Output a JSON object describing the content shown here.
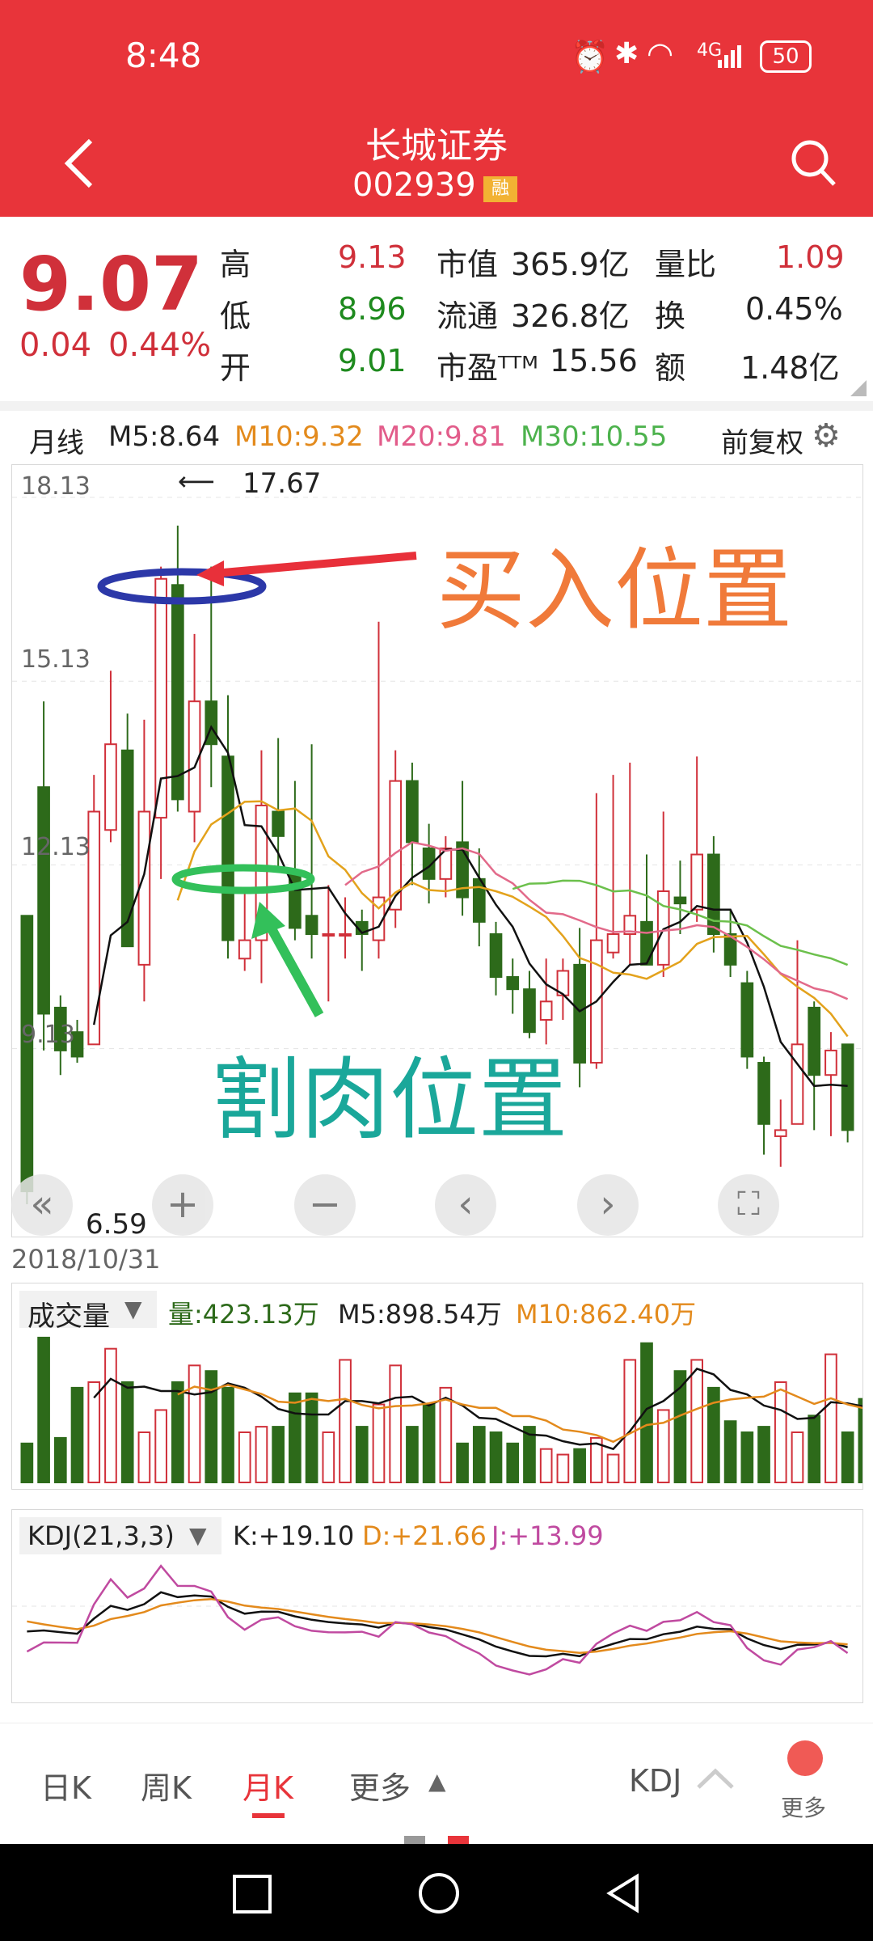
{
  "status": {
    "time": "8:48",
    "battery": "50",
    "network": "4G"
  },
  "header": {
    "stock_name": "长城证券",
    "stock_code": "002939",
    "rong_badge": "融"
  },
  "quote": {
    "price": "9.07",
    "change": "0.04",
    "change_pct": "0.44%",
    "high_label": "高",
    "high": "9.13",
    "low_label": "低",
    "low": "8.96",
    "open_label": "开",
    "open": "9.01",
    "mcap_label": "市值",
    "mcap": "365.9亿",
    "float_label": "流通",
    "float": "326.8亿",
    "pe_label": "市盈ᵀᵀᴹ",
    "pe": "15.56",
    "vr_label": "量比",
    "vr": "1.09",
    "turnover_label": "换",
    "turnover": "0.45%",
    "amount_label": "额",
    "amount": "1.48亿"
  },
  "ma_bar": {
    "period": "月线",
    "m5": "M5:8.64",
    "m10": "M10:9.32",
    "m20": "M20:9.81",
    "m30": "M30:10.55",
    "adjust": "前复权"
  },
  "main_chart": {
    "y_labels": [
      "18.13",
      "15.13",
      "12.13",
      "9.13"
    ],
    "max_annotation": "17.67",
    "min_annotation": "6.59",
    "date": "2018/10/31",
    "buy_label": "买入位置",
    "sell_label": "割肉位置"
  },
  "volume": {
    "selector": "成交量",
    "vol": "量:423.13万",
    "m5": "M5:898.54万",
    "m10": "M10:862.40万"
  },
  "kdj": {
    "selector": "KDJ(21,3,3)",
    "k": "K:+19.10",
    "d": "D:+21.66",
    "j": "J:+13.99"
  },
  "bottom_tabs": {
    "day": "日K",
    "week": "周K",
    "month": "月K",
    "more": "更多",
    "indicator": "KDJ",
    "more2": "更多"
  },
  "colors": {
    "up": "#d0303a",
    "down": "#2d6a1a",
    "header": "#e8343a"
  },
  "chart_data": {
    "type": "candlestick",
    "period": "monthly",
    "yrange": [
      6.59,
      18.13
    ],
    "candles": [
      {
        "o": 11.3,
        "c": 6.8,
        "h": 11.3,
        "l": 6.59
      },
      {
        "o": 13.4,
        "c": 9.7,
        "h": 14.8,
        "l": 9.1
      },
      {
        "o": 9.8,
        "c": 9.1,
        "h": 10.0,
        "l": 8.7
      },
      {
        "o": 9.4,
        "c": 9.0,
        "h": 9.6,
        "l": 8.9
      },
      {
        "o": 9.2,
        "c": 13.0,
        "h": 13.6,
        "l": 9.2
      },
      {
        "o": 12.7,
        "c": 14.1,
        "h": 15.3,
        "l": 12.5
      },
      {
        "o": 14.0,
        "c": 10.8,
        "h": 14.6,
        "l": 10.8
      },
      {
        "o": 10.5,
        "c": 13.0,
        "h": 14.5,
        "l": 9.9
      },
      {
        "o": 12.9,
        "c": 16.8,
        "h": 17.0,
        "l": 11.9
      },
      {
        "o": 16.7,
        "c": 13.2,
        "h": 17.67,
        "l": 13.0
      },
      {
        "o": 13.0,
        "c": 14.8,
        "h": 15.9,
        "l": 12.5
      },
      {
        "o": 14.8,
        "c": 14.1,
        "h": 17.0,
        "l": 13.4
      },
      {
        "o": 13.9,
        "c": 10.9,
        "h": 14.9,
        "l": 10.6
      },
      {
        "o": 10.6,
        "c": 10.9,
        "h": 11.7,
        "l": 10.4
      },
      {
        "o": 10.9,
        "c": 13.1,
        "h": 14.0,
        "l": 10.2
      },
      {
        "o": 13.0,
        "c": 12.6,
        "h": 14.2,
        "l": 12.1
      },
      {
        "o": 12.0,
        "c": 11.1,
        "h": 13.5,
        "l": 10.9
      },
      {
        "o": 11.3,
        "c": 11.0,
        "h": 14.1,
        "l": 10.6
      },
      {
        "o": 11.0,
        "c": 11.0,
        "h": 11.8,
        "l": 9.9
      },
      {
        "o": 11.0,
        "c": 11.0,
        "h": 11.6,
        "l": 10.6
      },
      {
        "o": 11.2,
        "c": 11.0,
        "h": 11.4,
        "l": 10.4
      },
      {
        "o": 10.9,
        "c": 11.6,
        "h": 16.1,
        "l": 10.6
      },
      {
        "o": 11.4,
        "c": 13.5,
        "h": 14.0,
        "l": 11.1
      },
      {
        "o": 13.5,
        "c": 12.5,
        "h": 13.8,
        "l": 11.8
      },
      {
        "o": 12.4,
        "c": 11.9,
        "h": 12.8,
        "l": 11.5
      },
      {
        "o": 11.9,
        "c": 12.4,
        "h": 12.6,
        "l": 11.6
      },
      {
        "o": 12.5,
        "c": 11.6,
        "h": 13.5,
        "l": 11.3
      },
      {
        "o": 11.9,
        "c": 11.2,
        "h": 12.4,
        "l": 10.8
      },
      {
        "o": 11.0,
        "c": 10.3,
        "h": 11.2,
        "l": 10.0
      },
      {
        "o": 10.3,
        "c": 10.1,
        "h": 10.6,
        "l": 9.7
      },
      {
        "o": 10.1,
        "c": 9.4,
        "h": 10.4,
        "l": 9.3
      },
      {
        "o": 9.6,
        "c": 9.9,
        "h": 10.6,
        "l": 9.2
      },
      {
        "o": 10.0,
        "c": 10.4,
        "h": 10.6,
        "l": 9.6
      },
      {
        "o": 10.5,
        "c": 8.9,
        "h": 11.1,
        "l": 8.5
      },
      {
        "o": 8.9,
        "c": 10.9,
        "h": 13.3,
        "l": 8.8
      },
      {
        "o": 10.7,
        "c": 11.0,
        "h": 13.6,
        "l": 10.6
      },
      {
        "o": 11.0,
        "c": 11.3,
        "h": 13.8,
        "l": 10.5
      },
      {
        "o": 11.2,
        "c": 10.5,
        "h": 12.3,
        "l": 10.5
      },
      {
        "o": 10.5,
        "c": 11.7,
        "h": 13.0,
        "l": 10.3
      },
      {
        "o": 11.6,
        "c": 11.5,
        "h": 12.2,
        "l": 11.0
      },
      {
        "o": 11.4,
        "c": 12.3,
        "h": 13.9,
        "l": 11.2
      },
      {
        "o": 12.3,
        "c": 11.0,
        "h": 12.6,
        "l": 10.7
      },
      {
        "o": 11.0,
        "c": 10.5,
        "h": 11.4,
        "l": 10.3
      },
      {
        "o": 10.2,
        "c": 9.0,
        "h": 10.4,
        "l": 8.8
      },
      {
        "o": 8.9,
        "c": 7.9,
        "h": 9.0,
        "l": 7.4
      },
      {
        "o": 7.7,
        "c": 7.8,
        "h": 8.3,
        "l": 7.2
      },
      {
        "o": 7.9,
        "c": 9.2,
        "h": 10.9,
        "l": 7.9
      },
      {
        "o": 9.8,
        "c": 8.7,
        "h": 9.9,
        "l": 7.8
      },
      {
        "o": 8.7,
        "c": 9.1,
        "h": 9.4,
        "l": 7.7
      },
      {
        "o": 9.2,
        "c": 7.8,
        "h": 9.2,
        "l": 7.6
      }
    ],
    "volumes": [
      7,
      26,
      8,
      17,
      18,
      24,
      18,
      9,
      13,
      18,
      21,
      20,
      17,
      9,
      10,
      10,
      16,
      16,
      9,
      22,
      10,
      14,
      21,
      10,
      14,
      17,
      7,
      10,
      9,
      7,
      10,
      6,
      5,
      6,
      8,
      5,
      22,
      25,
      13,
      20,
      22,
      17,
      11,
      9,
      10,
      18,
      9,
      12,
      23,
      9,
      15,
      7
    ]
  }
}
